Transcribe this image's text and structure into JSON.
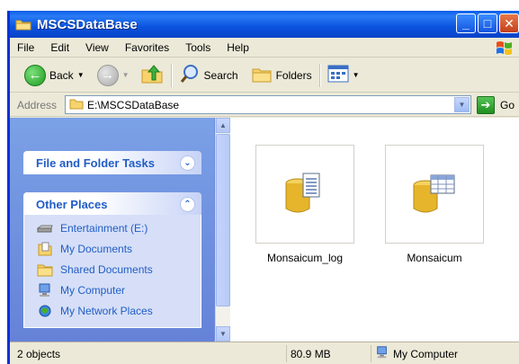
{
  "window": {
    "title": "MSCSDataBase"
  },
  "menu": {
    "items": [
      "File",
      "Edit",
      "View",
      "Favorites",
      "Tools",
      "Help"
    ]
  },
  "toolbar": {
    "back_label": "Back",
    "search_label": "Search",
    "folders_label": "Folders"
  },
  "address": {
    "label": "Address",
    "path": "E:\\MSCSDataBase",
    "go_label": "Go"
  },
  "taskpane": {
    "file_tasks_title": "File and Folder Tasks",
    "other_places_title": "Other Places",
    "places": [
      {
        "label": "Entertainment (E:)",
        "icon": "drive-icon"
      },
      {
        "label": "My Documents",
        "icon": "my-documents-icon"
      },
      {
        "label": "Shared Documents",
        "icon": "shared-documents-icon"
      },
      {
        "label": "My Computer",
        "icon": "my-computer-icon"
      },
      {
        "label": "My Network Places",
        "icon": "network-places-icon"
      }
    ]
  },
  "files": [
    {
      "name": "Monsaicum_log",
      "icon": "database-log-icon"
    },
    {
      "name": "Monsaicum",
      "icon": "database-table-icon"
    }
  ],
  "status": {
    "count": "2 objects",
    "size": "80.9 MB",
    "location": "My Computer"
  },
  "colors": {
    "title_bar": "#0a53de",
    "task_pane": "#7ba1e6",
    "link_blue": "#215dc6"
  }
}
